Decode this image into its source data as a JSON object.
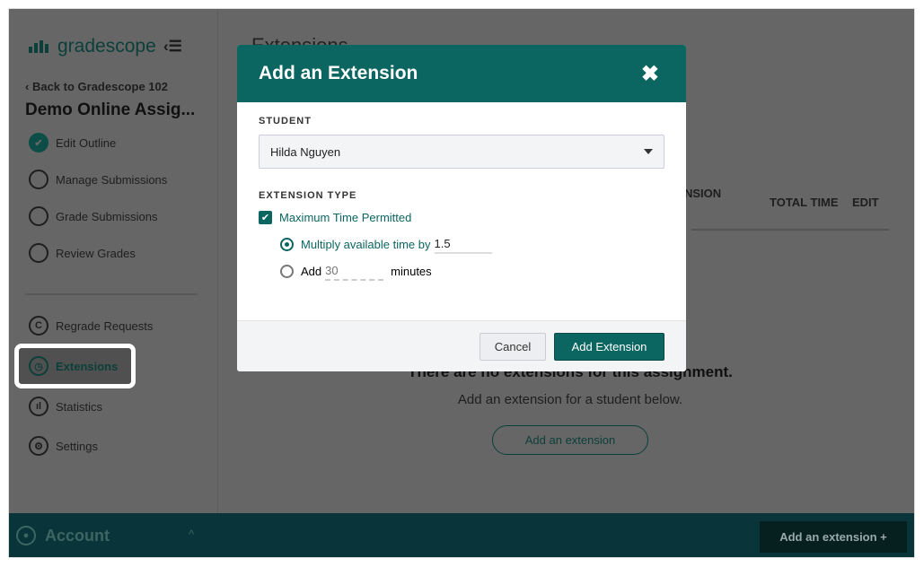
{
  "sidebar": {
    "brand": "gradescope",
    "back_link": "Back to Gradescope 102",
    "assignment_title": "Demo Online Assig...",
    "steps": [
      {
        "label": "Edit Outline",
        "done": true
      },
      {
        "label": "Manage Submissions"
      },
      {
        "label": "Grade Submissions"
      },
      {
        "label": "Review Grades"
      }
    ],
    "tools": [
      {
        "label": "Regrade Requests"
      },
      {
        "label": "Extensions",
        "active": true
      },
      {
        "label": "Statistics"
      },
      {
        "label": "Settings"
      }
    ],
    "account": "Account"
  },
  "main": {
    "title": "Extensions",
    "columns": [
      "NSION",
      "TOTAL TIME",
      "EDIT"
    ],
    "empty_title": "There are no extensions for this assignment.",
    "empty_sub": "Add an extension for a student below.",
    "empty_button": "Add an extension",
    "bottom_button": "Add an extension +"
  },
  "modal": {
    "title": "Add an Extension",
    "student_label": "STUDENT",
    "student_value": "Hilda Nguyen",
    "type_label": "EXTENSION TYPE",
    "max_time_label": "Maximum Time Permitted",
    "max_time_checked": true,
    "multiply_label": "Multiply available time by",
    "multiply_value": "1.5",
    "add_label": "Add",
    "add_placeholder": "30",
    "minutes_label": "minutes",
    "cancel": "Cancel",
    "submit": "Add Extension"
  },
  "colors": {
    "brand": "#0b6560",
    "bottom_bar": "#08343a"
  }
}
